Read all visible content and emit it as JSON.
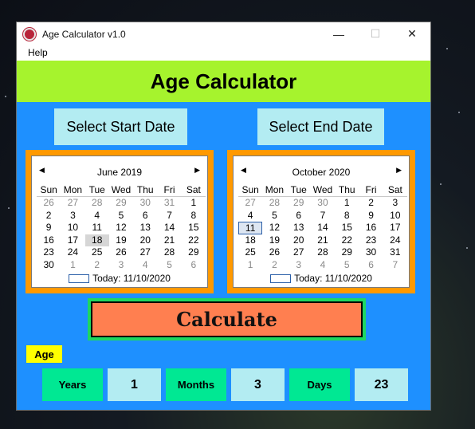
{
  "window": {
    "title": "Age Calculator v1.0",
    "minimize": "—",
    "maximize": "☐",
    "close": "✕"
  },
  "menu": {
    "help": "Help"
  },
  "header": {
    "title": "Age Calculator"
  },
  "buttons": {
    "select_start": "Select Start Date",
    "select_end": "Select End Date",
    "calculate": "Calculate"
  },
  "weekdays": [
    "Sun",
    "Mon",
    "Tue",
    "Wed",
    "Thu",
    "Fri",
    "Sat"
  ],
  "start_calendar": {
    "month": "June 2019",
    "prev": "◀",
    "next": "▶",
    "today_label": "Today: 11/10/2020",
    "weeks": [
      [
        {
          "d": "26",
          "m": true
        },
        {
          "d": "27",
          "m": true
        },
        {
          "d": "28",
          "m": true
        },
        {
          "d": "29",
          "m": true
        },
        {
          "d": "30",
          "m": true
        },
        {
          "d": "31",
          "m": true
        },
        {
          "d": "1"
        }
      ],
      [
        {
          "d": "2"
        },
        {
          "d": "3"
        },
        {
          "d": "4"
        },
        {
          "d": "5"
        },
        {
          "d": "6"
        },
        {
          "d": "7"
        },
        {
          "d": "8"
        }
      ],
      [
        {
          "d": "9"
        },
        {
          "d": "10"
        },
        {
          "d": "11"
        },
        {
          "d": "12"
        },
        {
          "d": "13"
        },
        {
          "d": "14"
        },
        {
          "d": "15"
        }
      ],
      [
        {
          "d": "16"
        },
        {
          "d": "17"
        },
        {
          "d": "18",
          "sel": true
        },
        {
          "d": "19"
        },
        {
          "d": "20"
        },
        {
          "d": "21"
        },
        {
          "d": "22"
        }
      ],
      [
        {
          "d": "23"
        },
        {
          "d": "24"
        },
        {
          "d": "25"
        },
        {
          "d": "26"
        },
        {
          "d": "27"
        },
        {
          "d": "28"
        },
        {
          "d": "29"
        }
      ],
      [
        {
          "d": "30"
        },
        {
          "d": "1",
          "m": true
        },
        {
          "d": "2",
          "m": true
        },
        {
          "d": "3",
          "m": true
        },
        {
          "d": "4",
          "m": true
        },
        {
          "d": "5",
          "m": true
        },
        {
          "d": "6",
          "m": true
        }
      ]
    ]
  },
  "end_calendar": {
    "month": "October 2020",
    "prev": "◀",
    "next": "▶",
    "today_label": "Today: 11/10/2020",
    "weeks": [
      [
        {
          "d": "27",
          "m": true
        },
        {
          "d": "28",
          "m": true
        },
        {
          "d": "29",
          "m": true
        },
        {
          "d": "30",
          "m": true
        },
        {
          "d": "1"
        },
        {
          "d": "2"
        },
        {
          "d": "3"
        }
      ],
      [
        {
          "d": "4"
        },
        {
          "d": "5"
        },
        {
          "d": "6"
        },
        {
          "d": "7"
        },
        {
          "d": "8"
        },
        {
          "d": "9"
        },
        {
          "d": "10"
        }
      ],
      [
        {
          "d": "11",
          "today": true
        },
        {
          "d": "12"
        },
        {
          "d": "13"
        },
        {
          "d": "14"
        },
        {
          "d": "15"
        },
        {
          "d": "16"
        },
        {
          "d": "17"
        }
      ],
      [
        {
          "d": "18"
        },
        {
          "d": "19"
        },
        {
          "d": "20"
        },
        {
          "d": "21"
        },
        {
          "d": "22"
        },
        {
          "d": "23"
        },
        {
          "d": "24"
        }
      ],
      [
        {
          "d": "25"
        },
        {
          "d": "26"
        },
        {
          "d": "27"
        },
        {
          "d": "28"
        },
        {
          "d": "29"
        },
        {
          "d": "30"
        },
        {
          "d": "31"
        }
      ],
      [
        {
          "d": "1",
          "m": true
        },
        {
          "d": "2",
          "m": true
        },
        {
          "d": "3",
          "m": true
        },
        {
          "d": "4",
          "m": true
        },
        {
          "d": "5",
          "m": true
        },
        {
          "d": "6",
          "m": true
        },
        {
          "d": "7",
          "m": true
        }
      ]
    ]
  },
  "result": {
    "age_label": "Age",
    "years_label": "Years",
    "years_value": "1",
    "months_label": "Months",
    "months_value": "3",
    "days_label": "Days",
    "days_value": "23"
  },
  "colors": {
    "window_bg": "#1e90ff",
    "header_bg": "#a6f32d",
    "calendar_frame": "#ff9900",
    "calculate_bg": "#ff7f50",
    "calculate_border": "#1ed760",
    "age_badge": "#ffff00",
    "result_label_bg": "#00e893",
    "result_value_bg": "#b3ecf2"
  }
}
